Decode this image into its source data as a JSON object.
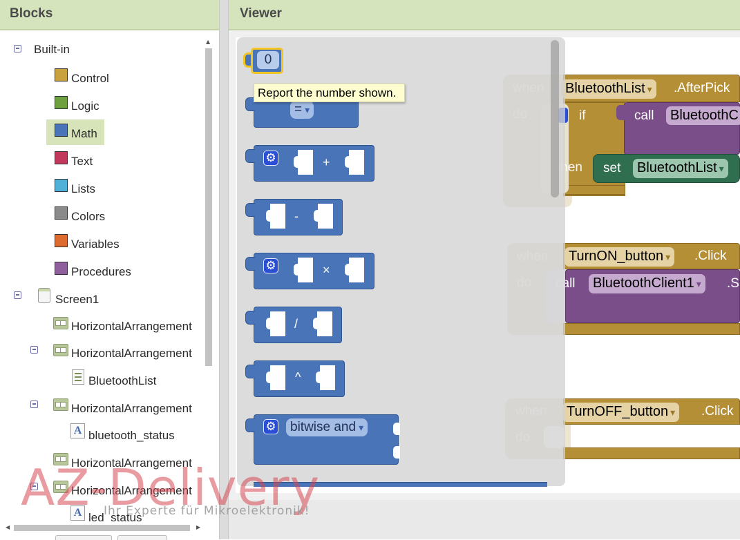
{
  "blocks_panel": {
    "title": "Blocks",
    "builtin_label": "Built-in",
    "builtin_items": [
      {
        "label": "Control",
        "color": "#c9a13f"
      },
      {
        "label": "Logic",
        "color": "#6fa03f"
      },
      {
        "label": "Math",
        "color": "#4a74b8"
      },
      {
        "label": "Text",
        "color": "#c2385c"
      },
      {
        "label": "Lists",
        "color": "#4fb0d8"
      },
      {
        "label": "Colors",
        "color": "#8a8a8a"
      },
      {
        "label": "Variables",
        "color": "#dd6a2e"
      },
      {
        "label": "Procedures",
        "color": "#8e5f9c"
      }
    ],
    "selected": "Math",
    "screen_label": "Screen1",
    "components": [
      "HorizontalArrangement",
      "HorizontalArrangement",
      "BluetoothList",
      "HorizontalArrangement",
      "bluetooth_status",
      "HorizontalArrangement",
      "HorizontalArrangement",
      "led_status"
    ]
  },
  "viewer": {
    "title": "Viewer",
    "number_block_value": "0",
    "tooltip": "Report the number shown.",
    "compare_op": "=",
    "ops": [
      "+",
      "-",
      "×",
      "/",
      "^"
    ],
    "bitwise_op": "bitwise and",
    "dropdown_arrow": "▾",
    "gear_glyph": "⚙"
  },
  "events": {
    "e1": {
      "when": "when",
      "do": "do",
      "component": "BluetoothList",
      "event": ".AfterPick",
      "if": "if",
      "call": "call",
      "call_target": "BluetoothC",
      "then": "then",
      "set": "set",
      "set_target": "BluetoothList"
    },
    "e2": {
      "when": "when",
      "do": "do",
      "component": "TurnON_button",
      "event": ".Click",
      "call": "call",
      "call_target": "BluetoothClient1",
      "call_method": ".S"
    },
    "e3": {
      "when": "when",
      "do": "do",
      "component": "TurnOFF_button",
      "event": ".Click"
    }
  },
  "watermark": {
    "brand": "AZ-Delivery",
    "tagline": "Ihr Experte für Mikroelektronik!"
  }
}
